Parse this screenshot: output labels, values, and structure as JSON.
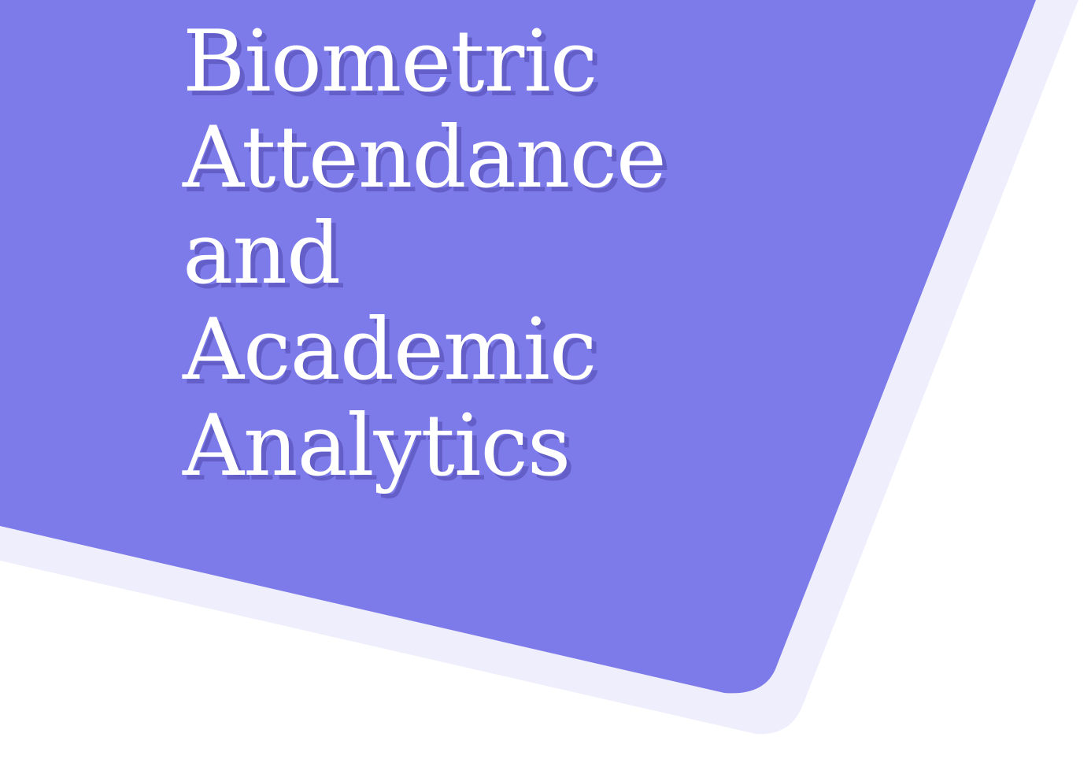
{
  "colors": {
    "page_background": "#ffffff",
    "card_fill": "#7c7be9",
    "card_shadow": "#efeefc",
    "title_text": "#ffffff"
  },
  "title": {
    "lines": [
      "Biometric",
      "Attendance",
      "and",
      "Academic",
      "Analytics"
    ]
  }
}
